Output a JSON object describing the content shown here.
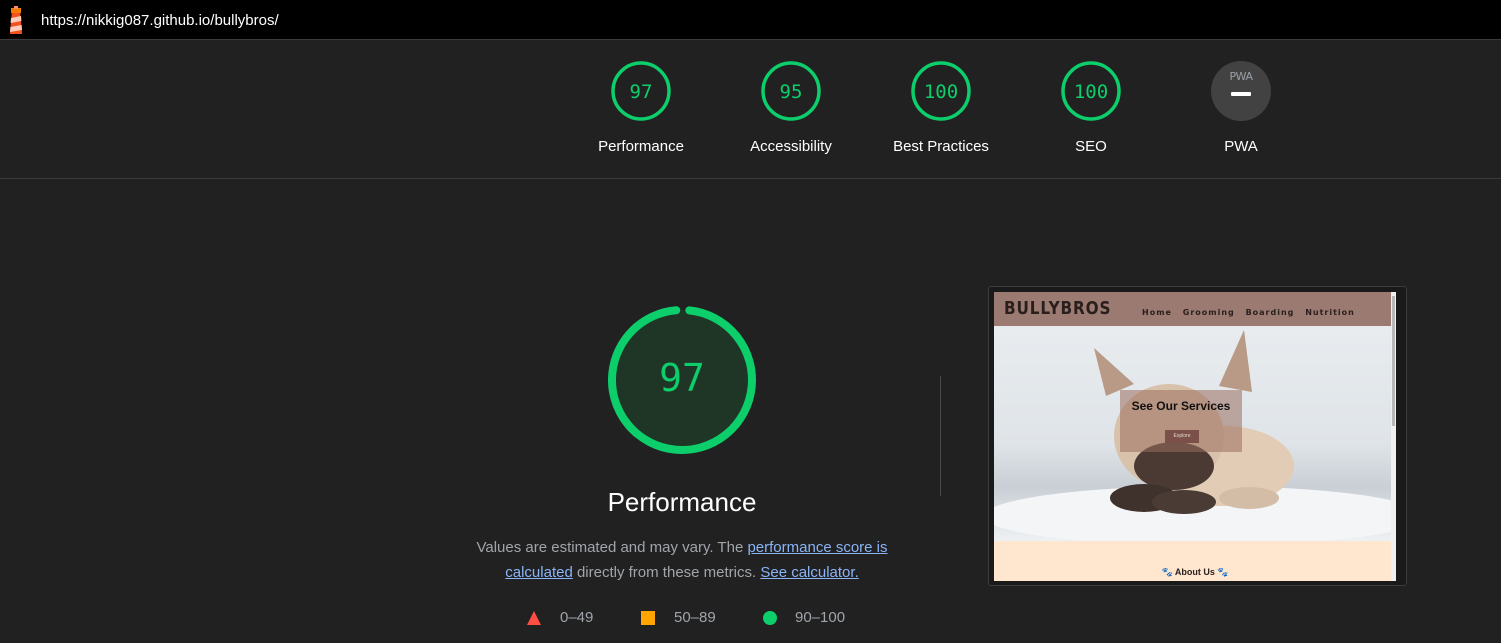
{
  "topbar": {
    "url": "https://nikkig087.github.io/bullybros/",
    "icon": "lighthouse-icon"
  },
  "colors": {
    "pass": "#0cce6b",
    "average": "#ffa400",
    "fail": "#ff4e42",
    "link": "#8ab4f8"
  },
  "gauges": [
    {
      "label": "Performance",
      "score": "97"
    },
    {
      "label": "Accessibility",
      "score": "95"
    },
    {
      "label": "Best Practices",
      "score": "100"
    },
    {
      "label": "SEO",
      "score": "100"
    },
    {
      "label": "PWA",
      "badge_text": "PWA",
      "score": null
    }
  ],
  "performance": {
    "score": "97",
    "title": "Performance",
    "desc_text_1": "Values are estimated and may vary. The ",
    "desc_link_1": "performance score is calculated",
    "desc_text_2": " directly from these metrics. ",
    "desc_link_2": "See calculator.",
    "legend": [
      {
        "shape": "triangle",
        "range": "0–49"
      },
      {
        "shape": "square",
        "range": "50–89"
      },
      {
        "shape": "circle",
        "range": "90–100"
      }
    ]
  },
  "screenshot": {
    "brand": "BULLYBROS",
    "nav_links": [
      "Home",
      "Grooming",
      "Boarding",
      "Nutrition"
    ],
    "hero_title": "See Our Services",
    "hero_button": "Explore",
    "about": "🐾 About Us 🐾"
  }
}
